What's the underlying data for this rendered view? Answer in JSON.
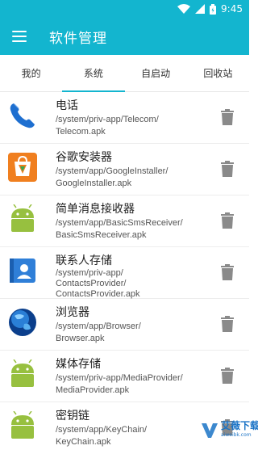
{
  "status_bar": {
    "time": "9:45"
  },
  "app_bar": {
    "title": "软件管理"
  },
  "tabs": [
    {
      "label": "我的",
      "active": false
    },
    {
      "label": "系统",
      "active": true
    },
    {
      "label": "自启动",
      "active": false
    },
    {
      "label": "回收站",
      "active": false
    }
  ],
  "apps": [
    {
      "name": "电话",
      "path_line1": "/system/priv-app/Telecom/",
      "path_line2": "Telecom.apk",
      "icon": "phone-icon"
    },
    {
      "name": "谷歌安装器",
      "path_line1": "/system/app/GoogleInstaller/",
      "path_line2": "GoogleInstaller.apk",
      "icon": "google-installer-icon"
    },
    {
      "name": "简单消息接收器",
      "path_line1": "/system/app/BasicSmsReceiver/",
      "path_line2": "BasicSmsReceiver.apk",
      "icon": "android-icon"
    },
    {
      "name": "联系人存储",
      "path_line1": "/system/priv-app/",
      "path_line2": "ContactsProvider/",
      "path_line3": "ContactsProvider.apk",
      "icon": "contacts-icon"
    },
    {
      "name": "浏览器",
      "path_line1": "/system/app/Browser/",
      "path_line2": "Browser.apk",
      "icon": "globe-icon"
    },
    {
      "name": "媒体存储",
      "path_line1": "/system/priv-app/MediaProvider/",
      "path_line2": "MediaProvider.apk",
      "icon": "android-icon"
    },
    {
      "name": "密钥链",
      "path_line1": "/system/app/KeyChain/",
      "path_line2": "KeyChain.apk",
      "icon": "android-icon"
    }
  ],
  "watermark": {
    "text": "艾薇下载",
    "sub": "aiweibk.com"
  },
  "colors": {
    "accent": "#13b5cf",
    "android_green": "#97c03f",
    "trash": "#8a8a8a"
  }
}
